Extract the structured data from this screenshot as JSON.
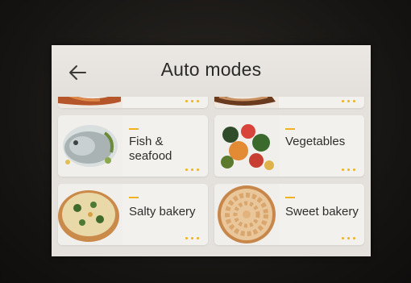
{
  "header": {
    "title": "Auto modes",
    "back_icon": "back-arrow-icon"
  },
  "modes": [
    {
      "label": "",
      "image": "roast-food-image",
      "menu_icon": "more-dots-icon"
    },
    {
      "label": "",
      "image": "pastry-food-image",
      "menu_icon": "more-dots-icon"
    },
    {
      "label": "Fish &\nseafood",
      "image": "fish-image",
      "menu_icon": "more-dots-icon"
    },
    {
      "label": "Vegetables",
      "image": "vegetables-image",
      "menu_icon": "more-dots-icon"
    },
    {
      "label": "Salty bakery",
      "image": "quiche-image",
      "menu_icon": "more-dots-icon"
    },
    {
      "label": "Sweet bakery",
      "image": "apple-tart-image",
      "menu_icon": "more-dots-icon"
    }
  ],
  "colors": {
    "accent": "#f0b21e",
    "screen_bg": "#e4e1dc",
    "tile_bg": "#f3f1ee",
    "text": "#2b2a28"
  }
}
